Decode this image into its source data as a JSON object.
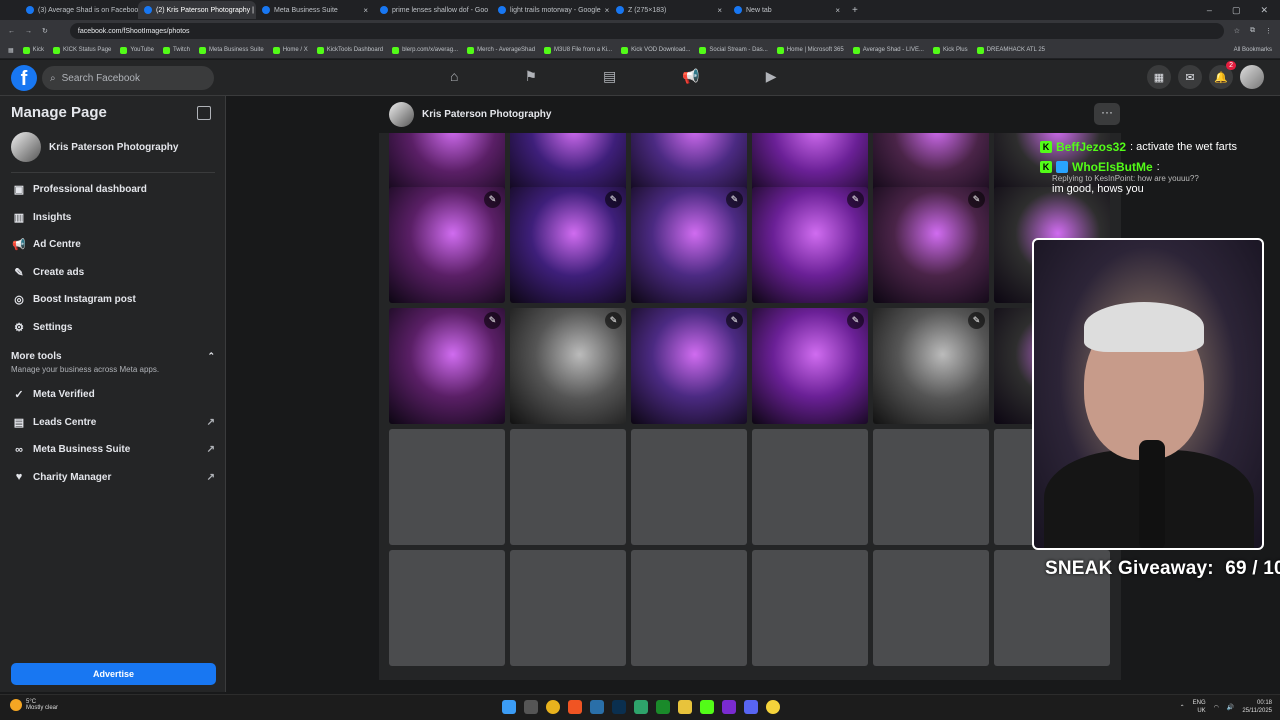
{
  "browser": {
    "tabs": [
      {
        "label": "(3) Average Shad is on Faceboo",
        "active": false
      },
      {
        "label": "(2) Kris Paterson Photography |",
        "active": true
      },
      {
        "label": "Meta Business Suite",
        "active": false
      },
      {
        "label": "prime lenses shallow dof - Goo",
        "active": false
      },
      {
        "label": "light trails motorway - Google",
        "active": false
      },
      {
        "label": "Z (275×183)",
        "active": false
      },
      {
        "label": "New tab",
        "active": false
      }
    ],
    "url": "facebook.com/fShootImages/photos",
    "bookmarks": [
      "Kick",
      "KICK Status Page",
      "YouTube",
      "Twitch",
      "Meta Business Suite",
      "Home / X",
      "KickTools Dashboard",
      "blerp.com/x/averag...",
      "Merch - AverageShad",
      "M3U8 File from a Ki...",
      "Kick VOD Download...",
      "Social Stream - Das...",
      "Home | Microsoft 365",
      "Average Shad - LIVE...",
      "Kick Plus",
      "DREAMHACK ATL 25"
    ],
    "all_bookmarks": "All Bookmarks"
  },
  "fb": {
    "logo": "f",
    "search_placeholder": "Search Facebook",
    "notification_count": "2"
  },
  "sidebar": {
    "title": "Manage Page",
    "page_name": "Kris Paterson Photography",
    "items": [
      {
        "label": "Professional dashboard",
        "icon": "dashboard-icon"
      },
      {
        "label": "Insights",
        "icon": "insights-icon"
      },
      {
        "label": "Ad Centre",
        "icon": "megaphone-icon"
      },
      {
        "label": "Create ads",
        "icon": "pencil-icon"
      },
      {
        "label": "Boost Instagram post",
        "icon": "instagram-icon"
      },
      {
        "label": "Settings",
        "icon": "gear-icon"
      }
    ],
    "more_tools": {
      "title": "More tools",
      "subtitle": "Manage your business across Meta apps.",
      "items": [
        {
          "label": "Meta Verified",
          "external": false
        },
        {
          "label": "Leads Centre",
          "external": true
        },
        {
          "label": "Meta Business Suite",
          "external": true
        },
        {
          "label": "Charity Manager",
          "external": true
        }
      ]
    },
    "advertise_label": "Advertise"
  },
  "content": {
    "page_name": "Kris Paterson Photography",
    "more_label": "···"
  },
  "photos": {
    "row_tops": [
      -50,
      54,
      175,
      296,
      417
    ],
    "col_colors": [
      "#5a1f66",
      "#3e1f7a",
      "#4b2a82",
      "#6a2096",
      "#4a2448",
      "#2a2a2a"
    ]
  },
  "chat": {
    "messages": [
      {
        "user": "BeffJezos32",
        "text": ": activate the wet farts"
      },
      {
        "user": "WhoElsButMe",
        "text": ":",
        "reply": "Replying to KesInPoint: how are youuu??",
        "body": "im good, hows you"
      }
    ]
  },
  "overlay": {
    "giveaway_label": "SNEAK Giveaway:",
    "giveaway_count": "69 / 100"
  },
  "taskbar": {
    "temp": "5°C",
    "weather": "Mostly clear",
    "lang": "ENG",
    "region": "UK",
    "time": "00:18",
    "date": "25/11/2025"
  }
}
